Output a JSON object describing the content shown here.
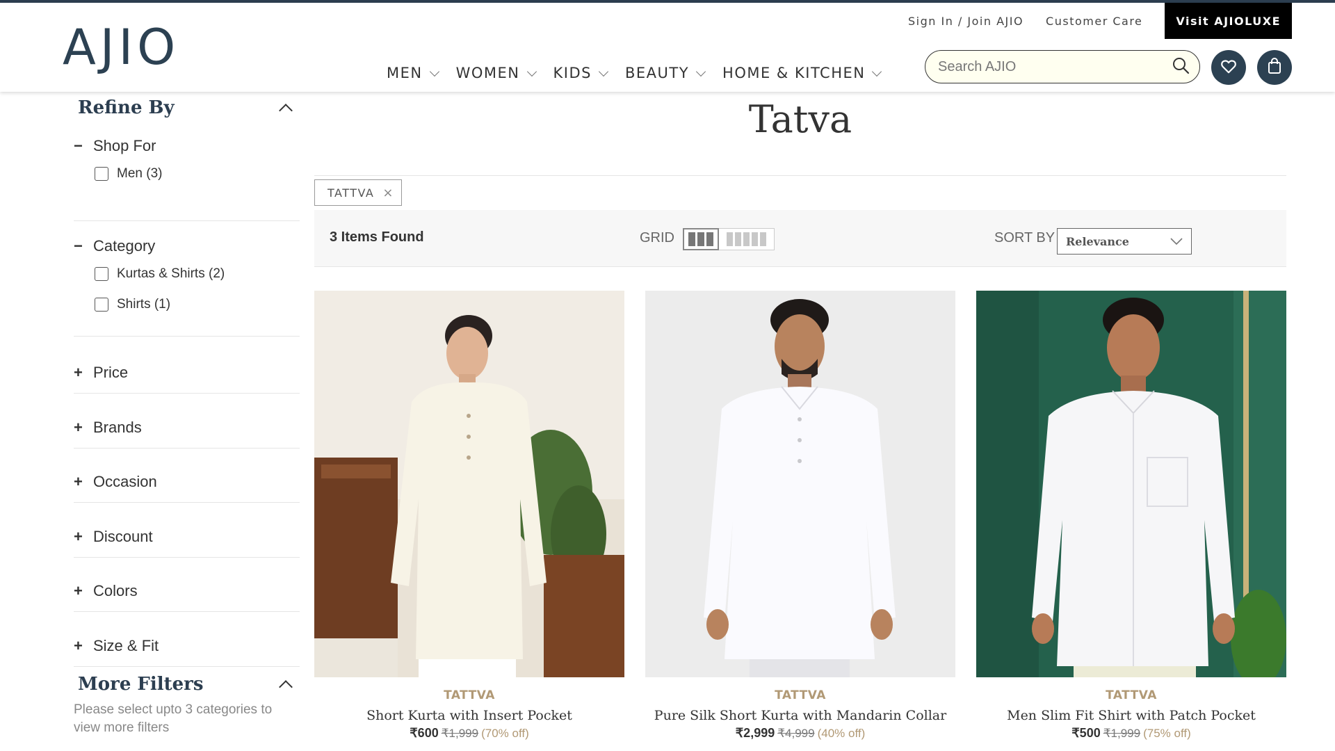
{
  "header": {
    "logo": "AJIO",
    "links": {
      "sign_in": "Sign In / Join AJIO",
      "customer_care": "Customer Care",
      "luxe": "Visit AJIOLUXE"
    },
    "nav": [
      "MEN",
      "WOMEN",
      "KIDS",
      "BEAUTY",
      "HOME & KITCHEN"
    ],
    "search_placeholder": "Search AJIO",
    "icons": {
      "wishlist": "heart-icon",
      "bag": "bag-icon",
      "search": "search-icon"
    }
  },
  "sidebar": {
    "title": "Refine By",
    "shop_for": {
      "label": "Shop For",
      "options": [
        "Men (3)"
      ]
    },
    "category": {
      "label": "Category",
      "options": [
        "Kurtas & Shirts (2)",
        "Shirts (1)"
      ]
    },
    "collapsed": [
      "Price",
      "Brands",
      "Occasion",
      "Discount",
      "Colors",
      "Size & Fit"
    ],
    "more_filters": {
      "title": "More Filters",
      "note": "Please select upto 3 categories to view more filters"
    }
  },
  "main": {
    "title": "Tatva",
    "chip": "TATTVA",
    "items_found": "3 Items Found",
    "grid_label": "GRID",
    "sort_label": "SORT BY",
    "sort_value": "Relevance"
  },
  "products": [
    {
      "brand": "TATTVA",
      "name": "Short Kurta with Insert Pocket",
      "price": "₹600",
      "mrp": "₹1,999",
      "discount": "(70% off)"
    },
    {
      "brand": "TATTVA",
      "name": "Pure Silk Short Kurta with Mandarin Collar",
      "price": "₹2,999",
      "mrp": "₹4,999",
      "discount": "(40% off)"
    },
    {
      "brand": "TATTVA",
      "name": "Men Slim Fit Shirt with Patch Pocket",
      "price": "₹500",
      "mrp": "₹1,999",
      "discount": "(75% off)"
    }
  ],
  "colors": {
    "brand_navy": "#2c4152",
    "brand_gold": "#b19975"
  }
}
